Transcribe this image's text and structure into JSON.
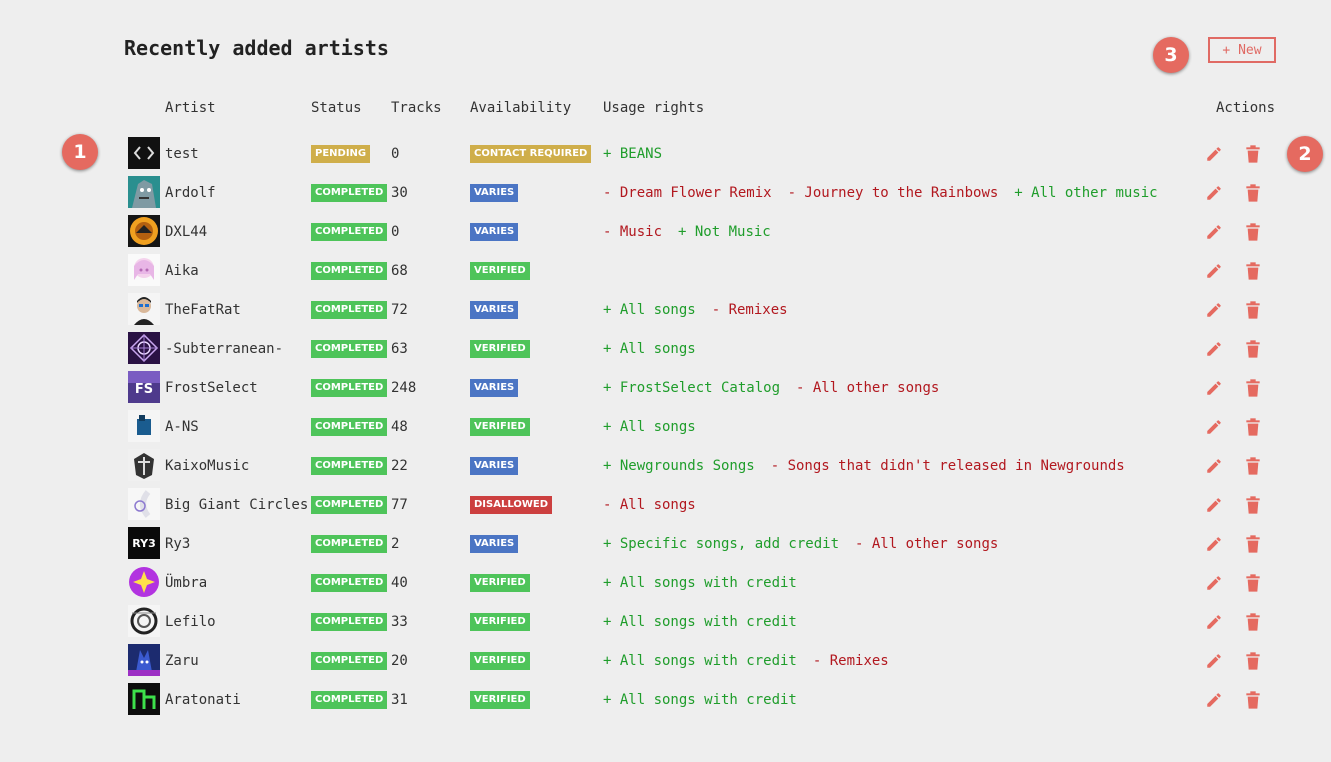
{
  "title": "Recently added artists",
  "new_button": "+ New",
  "markers": [
    "1",
    "2",
    "3"
  ],
  "columns": {
    "artist": "Artist",
    "status": "Status",
    "tracks": "Tracks",
    "availability": "Availability",
    "usage": "Usage rights",
    "actions": "Actions"
  },
  "colors": {
    "pending": "#cfae4a",
    "completed": "#4ec45a",
    "contact_required": "#cfae4a",
    "varies": "#4b75c4",
    "verified": "#4ec45a",
    "disallowed": "#cc3f3f",
    "allow_text": "#1f9d2b",
    "deny_text": "#b2181f",
    "action_icon": "#e56a60"
  },
  "artists": [
    {
      "name": "test",
      "status": "PENDING",
      "tracks": "0",
      "availability": "CONTACT REQUIRED",
      "usage": [
        {
          "text": "+ BEANS",
          "allow": true
        }
      ],
      "avatar": "code-avatar"
    },
    {
      "name": "Ardolf",
      "status": "COMPLETED",
      "tracks": "30",
      "availability": "VARIES",
      "usage": [
        {
          "text": "- Dream Flower Remix",
          "allow": false
        },
        {
          "text": "- Journey to the Rainbows",
          "allow": false
        },
        {
          "text": "+ All other music",
          "allow": true
        }
      ],
      "avatar": "ardolf-avatar"
    },
    {
      "name": "DXL44",
      "status": "COMPLETED",
      "tracks": "0",
      "availability": "VARIES",
      "usage": [
        {
          "text": "- Music",
          "allow": false
        },
        {
          "text": "+ Not Music",
          "allow": true
        }
      ],
      "avatar": "dxl44-avatar"
    },
    {
      "name": "Aika",
      "status": "COMPLETED",
      "tracks": "68",
      "availability": "VERIFIED",
      "usage": [],
      "avatar": "aika-avatar"
    },
    {
      "name": "TheFatRat",
      "status": "COMPLETED",
      "tracks": "72",
      "availability": "VARIES",
      "usage": [
        {
          "text": "+ All songs",
          "allow": true
        },
        {
          "text": "- Remixes",
          "allow": false
        }
      ],
      "avatar": "thefatrat-avatar"
    },
    {
      "name": "-Subterranean-",
      "status": "COMPLETED",
      "tracks": "63",
      "availability": "VERIFIED",
      "usage": [
        {
          "text": "+ All songs",
          "allow": true
        }
      ],
      "avatar": "subterranean-avatar"
    },
    {
      "name": "FrostSelect",
      "status": "COMPLETED",
      "tracks": "248",
      "availability": "VARIES",
      "usage": [
        {
          "text": "+ FrostSelect Catalog",
          "allow": true
        },
        {
          "text": "- All other songs",
          "allow": false
        }
      ],
      "avatar": "frostselect-avatar"
    },
    {
      "name": "A-NS",
      "status": "COMPLETED",
      "tracks": "48",
      "availability": "VERIFIED",
      "usage": [
        {
          "text": "+ All songs",
          "allow": true
        }
      ],
      "avatar": "a-ns-avatar"
    },
    {
      "name": "KaixoMusic",
      "status": "COMPLETED",
      "tracks": "22",
      "availability": "VARIES",
      "usage": [
        {
          "text": "+ Newgrounds Songs",
          "allow": true
        },
        {
          "text": "- Songs that didn't released in Newgrounds",
          "allow": false
        }
      ],
      "avatar": "kaixomusic-avatar"
    },
    {
      "name": "Big Giant Circles",
      "status": "COMPLETED",
      "tracks": "77",
      "availability": "DISALLOWED",
      "usage": [
        {
          "text": "- All songs",
          "allow": false
        }
      ],
      "avatar": "biggiantcircles-avatar"
    },
    {
      "name": "Ry3",
      "status": "COMPLETED",
      "tracks": "2",
      "availability": "VARIES",
      "usage": [
        {
          "text": "+ Specific songs, add credit",
          "allow": true
        },
        {
          "text": "- All other songs",
          "allow": false
        }
      ],
      "avatar": "ry3-avatar"
    },
    {
      "name": "Ümbra",
      "status": "COMPLETED",
      "tracks": "40",
      "availability": "VERIFIED",
      "usage": [
        {
          "text": "+ All songs with credit",
          "allow": true
        }
      ],
      "avatar": "umbra-avatar"
    },
    {
      "name": "Lefilo",
      "status": "COMPLETED",
      "tracks": "33",
      "availability": "VERIFIED",
      "usage": [
        {
          "text": "+ All songs with credit",
          "allow": true
        }
      ],
      "avatar": "lefilo-avatar"
    },
    {
      "name": "Zaru",
      "status": "COMPLETED",
      "tracks": "20",
      "availability": "VERIFIED",
      "usage": [
        {
          "text": "+ All songs with credit",
          "allow": true
        },
        {
          "text": "- Remixes",
          "allow": false
        }
      ],
      "avatar": "zaru-avatar"
    },
    {
      "name": "Aratonati",
      "status": "COMPLETED",
      "tracks": "31",
      "availability": "VERIFIED",
      "usage": [
        {
          "text": "+ All songs with credit",
          "allow": true
        }
      ],
      "avatar": "aratonati-avatar"
    }
  ]
}
